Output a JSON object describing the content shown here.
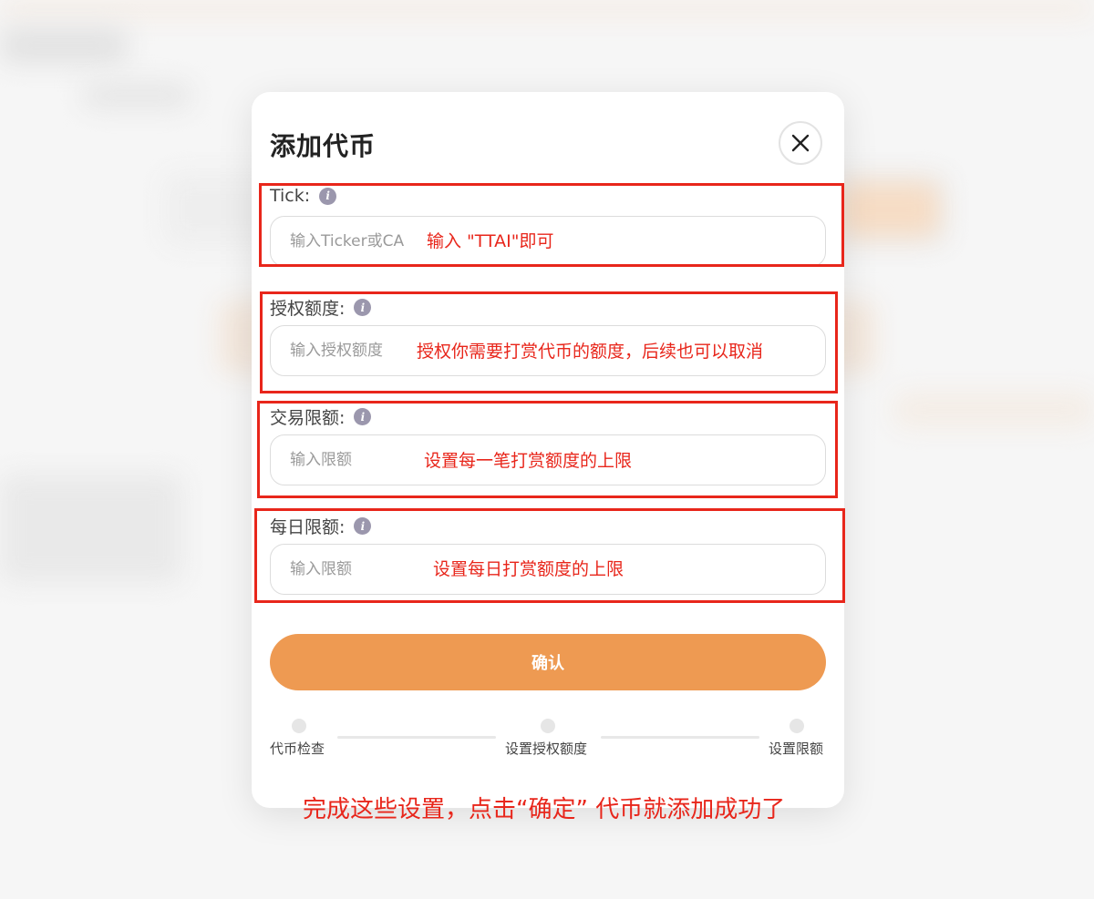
{
  "modal": {
    "title": "添加代币",
    "close_icon": "close-icon",
    "fields": [
      {
        "label": "Tick:",
        "placeholder": "输入Ticker或CA",
        "value": ""
      },
      {
        "label": "授权额度:",
        "placeholder": "输入授权额度",
        "value": ""
      },
      {
        "label": "交易限额:",
        "placeholder": "输入限额",
        "value": ""
      },
      {
        "label": "每日限额:",
        "placeholder": "输入限额",
        "value": ""
      }
    ],
    "info_icon": "info-icon",
    "confirm_label": "确认",
    "steps": [
      "代币检查",
      "设置授权额度",
      "设置限额"
    ]
  },
  "annotations": {
    "tick_hint": "输入 \"TTAI\"即可",
    "allowance_hint": "授权你需要打赏代币的额度，后续也可以取消",
    "tx_limit_hint": "设置每一笔打赏额度的上限",
    "daily_limit_hint": "设置每日打赏额度的上限",
    "footer_note": "完成这些设置，点击“确定” 代币就添加成功了"
  },
  "colors": {
    "accent": "#ee9a52",
    "annotation": "#e8261b",
    "info_icon": "#9b97ad"
  }
}
